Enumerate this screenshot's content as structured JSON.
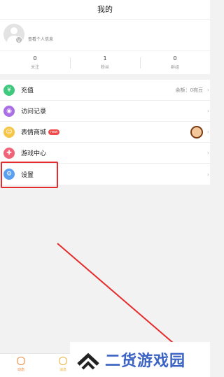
{
  "header": {
    "title": "我的"
  },
  "profile": {
    "badge": "V",
    "link_text": "查看个人信息"
  },
  "stats": [
    {
      "num": "0",
      "label": "关注"
    },
    {
      "num": "1",
      "label": "粉丝"
    },
    {
      "num": "0",
      "label": "群组"
    }
  ],
  "menu": {
    "recharge": {
      "label": "充值",
      "right": "余额：0宛豆",
      "icon_color": "#3ec97e"
    },
    "visits": {
      "label": "访问记录",
      "icon_color": "#a96ee6"
    },
    "stickers": {
      "label": "表情商城",
      "tag": "new",
      "icon_color": "#f7c545"
    },
    "games": {
      "label": "游戏中心",
      "icon_color": "#f0647a"
    },
    "settings": {
      "label": "设置",
      "icon_color": "#5aa0f0"
    }
  },
  "tabs": [
    {
      "label": "动态",
      "color": "#f08a3c"
    },
    {
      "label": "消息",
      "color": "#f0b23c"
    }
  ],
  "watermark": {
    "text": "二货游戏园"
  },
  "colors": {
    "highlight": "#e52b2b",
    "watermark": "#3b63c4"
  }
}
